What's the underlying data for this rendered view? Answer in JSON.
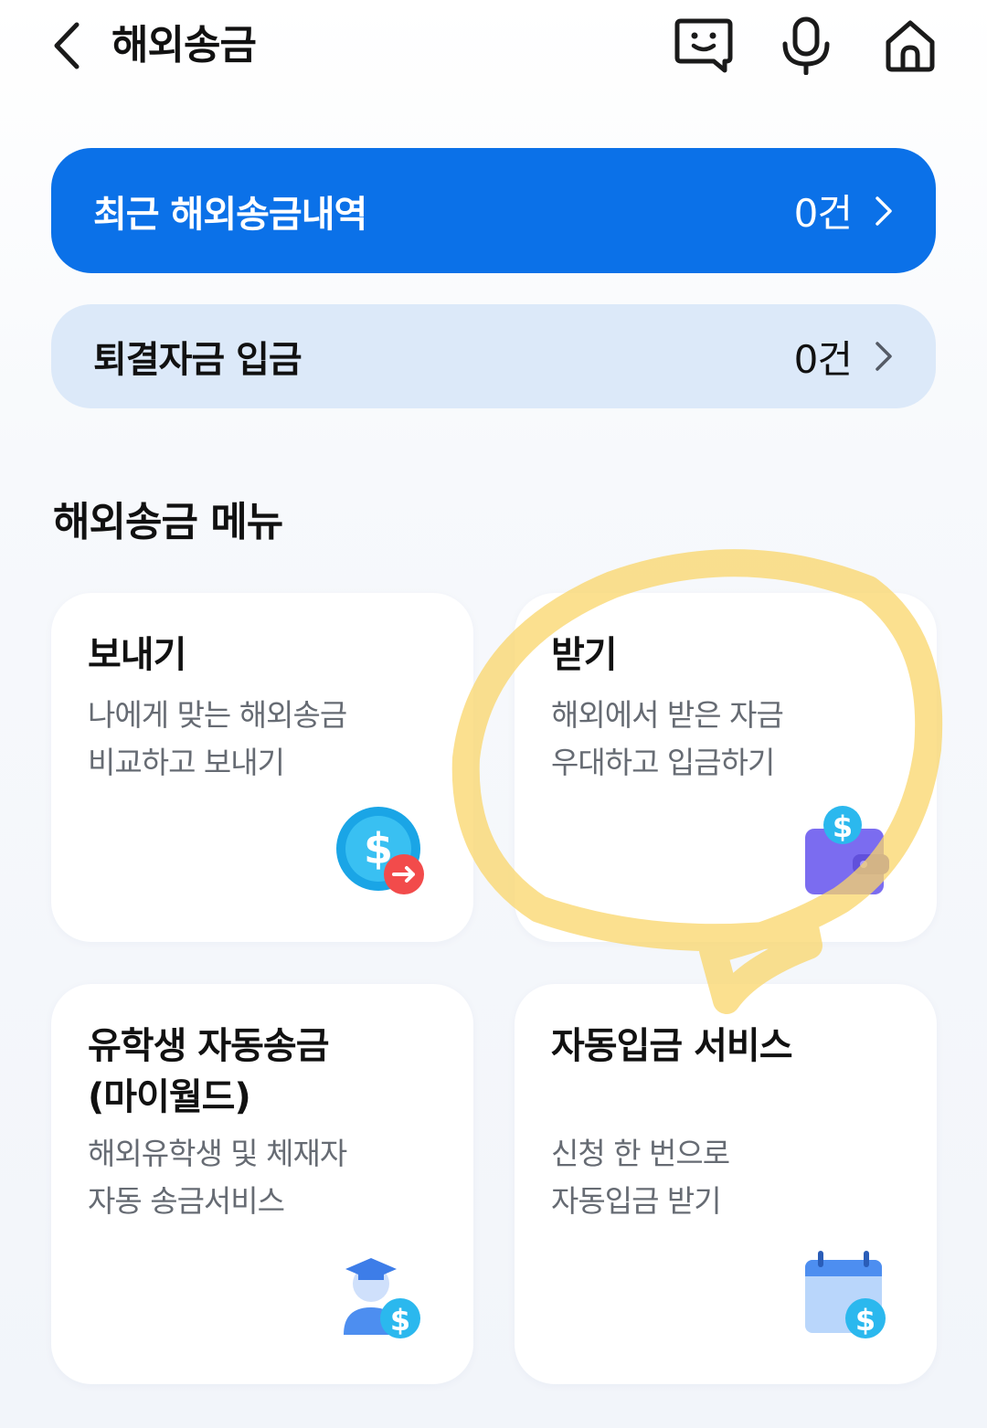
{
  "header": {
    "title": "해외송금",
    "back_icon": "chevron-left-icon",
    "actions": [
      {
        "name": "chat-icon"
      },
      {
        "name": "mic-icon"
      },
      {
        "name": "home-icon"
      }
    ]
  },
  "banners": {
    "recent": {
      "label": "최근 해외송금내역",
      "count": "0건"
    },
    "returned": {
      "label": "퇴결자금 입금",
      "count": "0건"
    }
  },
  "section": {
    "title": "해외송금 메뉴"
  },
  "cards": {
    "send": {
      "title": "보내기",
      "desc1": "나에게 맞는 해외송금",
      "desc2": "비교하고 보내기",
      "icon": "send-money-icon"
    },
    "receive": {
      "title": "받기",
      "desc1": "해외에서 받은 자금",
      "desc2": "우대하고 입금하기",
      "icon": "wallet-money-icon"
    },
    "study": {
      "title1": "유학생 자동송금",
      "title2": "(마이월드)",
      "desc1": "해외유학생 및 체재자",
      "desc2": "자동 송금서비스",
      "icon": "student-money-icon"
    },
    "auto": {
      "title": "자동입금 서비스",
      "desc1": "신청 한 번으로",
      "desc2": "자동입금 받기",
      "icon": "calendar-money-icon"
    }
  },
  "colors": {
    "primary": "#0b71e8",
    "secondary_bg": "#dce9f9",
    "highlight": "#f9d56a"
  }
}
